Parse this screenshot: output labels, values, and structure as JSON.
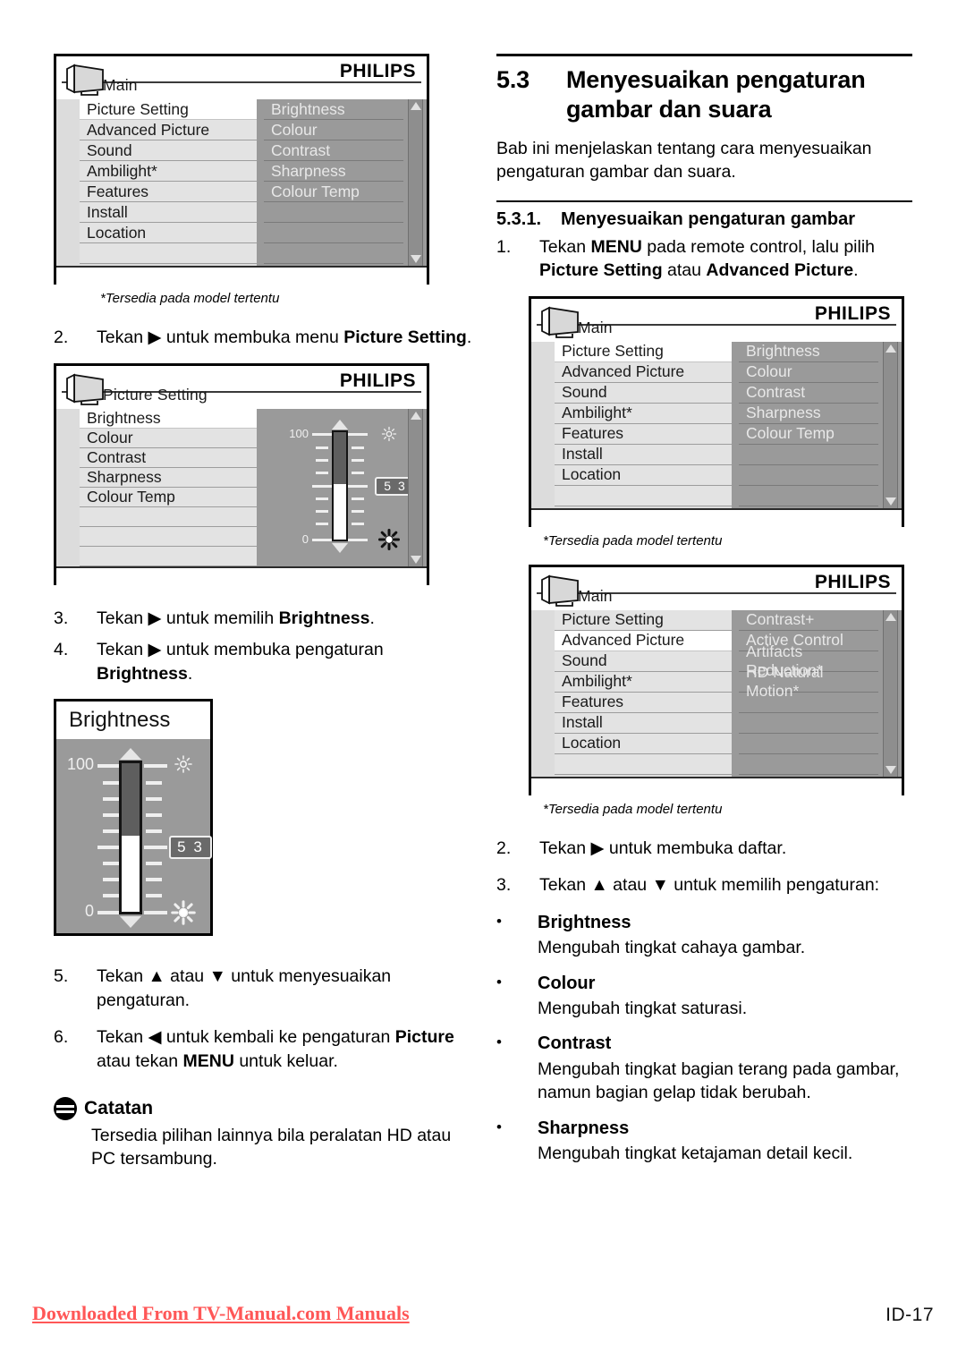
{
  "document": {
    "section_number": "5.3",
    "section_title": "Menyesuaikan pengaturan gambar dan suara",
    "section_title_line1": "Menyesuaikan pengaturan",
    "section_title_line2": "gambar dan suara",
    "intro": "Bab ini menjelaskan tentang cara menyesuaikan pengaturan gambar dan suara.",
    "subsection_number": "5.3.1.",
    "subsection_title": "Menyesuaikan pengaturan gambar",
    "footnote": "*Tersedia pada model tertentu",
    "footer_link": "Downloaded From TV-Manual.com Manuals",
    "page_number": "ID-17"
  },
  "left_column": {
    "step2": {
      "number": "2.",
      "text_pre": "Tekan ",
      "arrow": "▶",
      "text_mid": " untuk membuka menu ",
      "bold1": "Picture Setting",
      "text_end": "."
    },
    "step3": {
      "number": "3.",
      "text_pre": "Tekan ",
      "arrow": "▶",
      "text_mid": " untuk memilih ",
      "bold1": "Brightness",
      "text_end": "."
    },
    "step4": {
      "number": "4.",
      "text_pre": "Tekan ",
      "arrow": "▶",
      "text_mid": " untuk membuka pengaturan ",
      "bold1": "Brightness",
      "text_end": "."
    },
    "step5": {
      "number": "5.",
      "text_pre": "Tekan ",
      "arrow_up": "▲",
      "text_mid": " atau ",
      "arrow_dn": "▼",
      "text_end": " untuk menyesuaikan pengaturan."
    },
    "step6": {
      "number": "6.",
      "text_pre": "Tekan ",
      "arrow_left": "◀",
      "text_mid": " untuk kembali ke pengaturan ",
      "bold1": "Picture",
      "text_mid2": " atau tekan ",
      "bold2": "MENU",
      "text_end": " untuk keluar."
    },
    "note": {
      "title": "Catatan",
      "body": "Tersedia pilihan lainnya bila peralatan HD atau PC tersambung."
    }
  },
  "right_column": {
    "step1": {
      "number": "1.",
      "text_pre": "Tekan ",
      "bold_menu": "MENU",
      "text_mid": " pada remote control, lalu pilih ",
      "bold1": "Picture Setting",
      "text_mid2": " atau ",
      "bold2": "Advanced Picture",
      "text_end": "."
    },
    "step2": {
      "number": "2.",
      "text_pre": "Tekan ",
      "arrow": "▶",
      "text_end": " untuk membuka daftar."
    },
    "step3": {
      "number": "3.",
      "text_pre": "Tekan ",
      "arrow_up": "▲",
      "text_mid": " atau ",
      "arrow_dn": "▼",
      "text_end": " untuk memilih pengaturan:"
    },
    "bullets": [
      {
        "dot": "•",
        "heading": "Brightness",
        "desc": "Mengubah tingkat cahaya gambar."
      },
      {
        "dot": "•",
        "heading": "Colour",
        "desc": "Mengubah tingkat saturasi."
      },
      {
        "dot": "•",
        "heading": "Contrast",
        "desc": "Mengubah tingkat bagian terang pada gambar, namun bagian gelap tidak berubah."
      },
      {
        "dot": "•",
        "heading": "Sharpness",
        "desc": "Mengubah tingkat ketajaman detail kecil."
      }
    ]
  },
  "osd_main_menu": {
    "brand": "PHILIPS",
    "title": "Main",
    "left_items": [
      {
        "label": "Picture Setting",
        "selected": true
      },
      {
        "label": "Advanced Picture",
        "selected": false
      },
      {
        "label": "Sound",
        "selected": false
      },
      {
        "label": "Ambilight*",
        "selected": false
      },
      {
        "label": "Features",
        "selected": false
      },
      {
        "label": "Install",
        "selected": false
      },
      {
        "label": "Location",
        "selected": false
      },
      {
        "label": "",
        "selected": false
      }
    ],
    "right_items": [
      {
        "label": "Brightness"
      },
      {
        "label": "Colour"
      },
      {
        "label": "Contrast"
      },
      {
        "label": "Sharpness"
      },
      {
        "label": "Colour Temp"
      },
      {
        "label": ""
      },
      {
        "label": ""
      },
      {
        "label": ""
      }
    ]
  },
  "osd_advanced_menu": {
    "brand": "PHILIPS",
    "title": "Main",
    "left_items": [
      {
        "label": "Picture Setting",
        "selected": false
      },
      {
        "label": "Advanced Picture",
        "selected": true
      },
      {
        "label": "Sound",
        "selected": false
      },
      {
        "label": "Ambilight*",
        "selected": false
      },
      {
        "label": "Features",
        "selected": false
      },
      {
        "label": "Install",
        "selected": false
      },
      {
        "label": "Location",
        "selected": false
      },
      {
        "label": "",
        "selected": false
      }
    ],
    "right_items": [
      {
        "label": "Contrast+"
      },
      {
        "label": "Active Control"
      },
      {
        "label": "Artifacts Reduction*"
      },
      {
        "label": "HD Natural Motion*"
      },
      {
        "label": ""
      },
      {
        "label": ""
      },
      {
        "label": ""
      },
      {
        "label": ""
      }
    ]
  },
  "osd_picture_setting": {
    "brand": "PHILIPS",
    "title": "Picture Setting",
    "left_items": [
      {
        "label": "Brightness",
        "selected": true
      },
      {
        "label": "Colour",
        "selected": false
      },
      {
        "label": "Contrast",
        "selected": false
      },
      {
        "label": "Sharpness",
        "selected": false
      },
      {
        "label": "Colour Temp",
        "selected": false
      },
      {
        "label": "",
        "selected": false
      },
      {
        "label": "",
        "selected": false
      },
      {
        "label": "",
        "selected": false
      }
    ],
    "slider": {
      "max_label": "100",
      "min_label": "0",
      "value": "5 3",
      "value_number": 53,
      "top_icon": "sun-dim-icon",
      "bottom_icon": "sun-bright-icon"
    }
  },
  "brightness_panel": {
    "title": "Brightness",
    "slider": {
      "max_label": "100",
      "min_label": "0",
      "value": "5 3",
      "value_number": 53,
      "top_icon": "sun-dim-icon",
      "bottom_icon": "sun-bright-icon"
    }
  },
  "colors": {
    "osd_left_pane": "#dcdcdc",
    "osd_item": "#e3e3e3",
    "osd_right_pane": "#9a9a9a",
    "osd_selected": "#ffffff",
    "footer_link": "#ff5757"
  }
}
